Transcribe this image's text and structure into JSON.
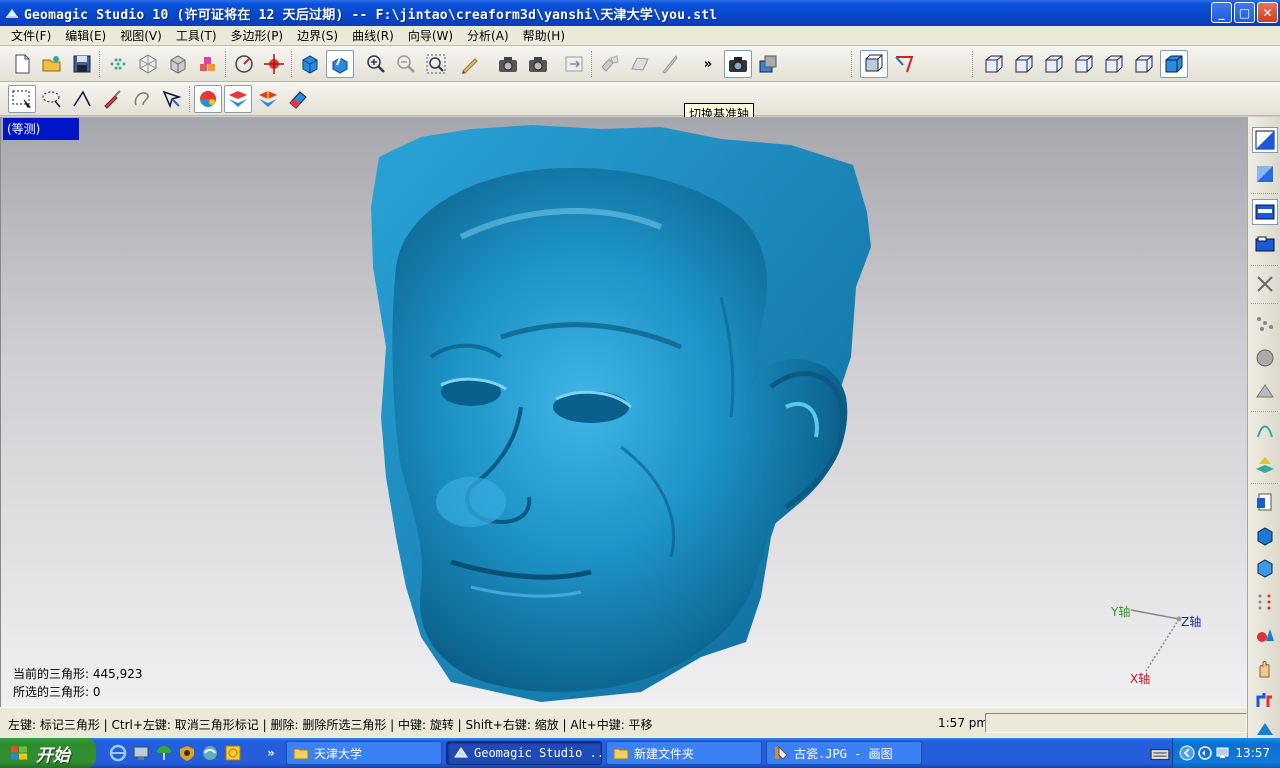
{
  "window": {
    "title": "Geomagic Studio 10 (许可证将在 12 天后过期) -- F:\\jintao\\creaform3d\\yanshi\\天津大学\\you.stl",
    "controls": [
      "_",
      "□",
      "✕"
    ]
  },
  "menu": [
    "文件(F)",
    "编辑(E)",
    "视图(V)",
    "工具(T)",
    "多边形(P)",
    "边界(S)",
    "曲线(R)",
    "向导(W)",
    "分析(A)",
    "帮助(H)"
  ],
  "toolbar": {
    "overflow_label": "»",
    "tooltip": "切换基准轴"
  },
  "viewport": {
    "view_label": "(等测)",
    "stats": {
      "current_triangles": "当前的三角形: 445,923",
      "selected_triangles": "所选的三角形: 0"
    },
    "axes": {
      "y": "Y轴",
      "z": "Z轴",
      "x": "X轴"
    },
    "model_color": "#1e8fc0"
  },
  "status": {
    "message": "左键: 标记三角形 | Ctrl+左键: 取消三角形标记 | 删除: 删除所选三角形 | 中键: 旋转 | Shift+右键: 缩放 | Alt+中键: 平移",
    "time": "1:57 pm"
  },
  "taskbar": {
    "start_label": "开始",
    "tasks": [
      {
        "label": "天津大学",
        "icon": "folder-icon"
      },
      {
        "label": "Geomagic Studio ...",
        "icon": "geomagic-icon"
      },
      {
        "label": "新建文件夹",
        "icon": "folder-icon"
      },
      {
        "label": "古瓷.JPG - 画图",
        "icon": "paint-icon"
      }
    ],
    "quicklaunch_overflow": "»",
    "clock": "13:57"
  }
}
